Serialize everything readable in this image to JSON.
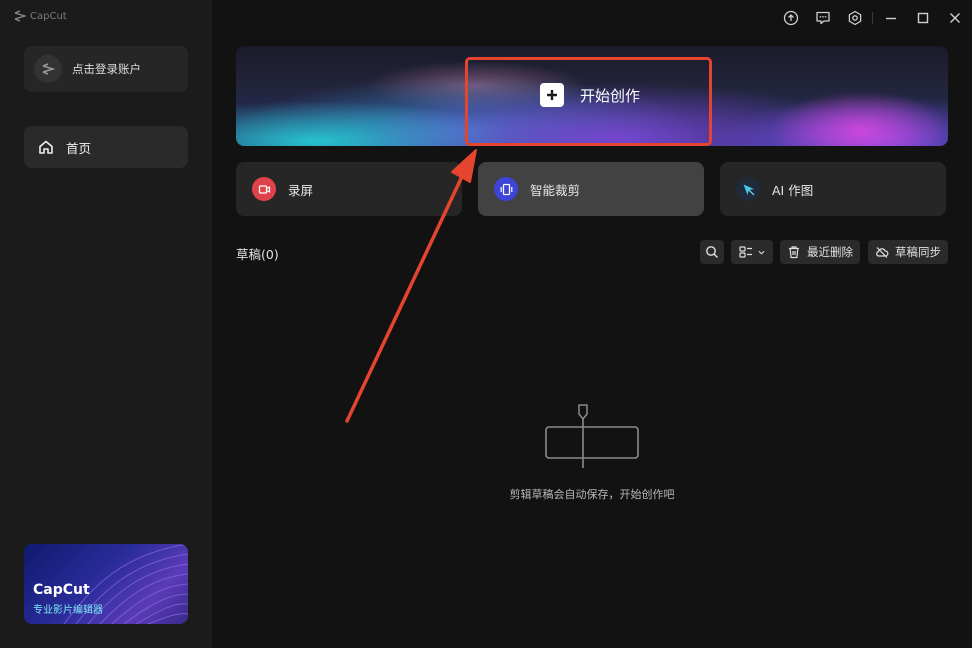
{
  "app": {
    "logo_text": "CapCut"
  },
  "sidebar": {
    "login_label": "点击登录账户",
    "nav": [
      {
        "label": "首页",
        "icon": "home-icon"
      }
    ],
    "promo": {
      "title": "CapCut",
      "subtitle": "专业影片编辑器"
    }
  },
  "titlebar": {
    "icons": [
      "upload-icon",
      "feedback-icon",
      "settings-icon",
      "minimize-icon",
      "maximize-icon",
      "close-icon"
    ]
  },
  "hero": {
    "label": "开始创作",
    "icon": "plus-icon"
  },
  "quick_actions": [
    {
      "label": "录屏",
      "icon": "screen-record-icon",
      "color": "#e0424c"
    },
    {
      "label": "智能裁剪",
      "icon": "smart-crop-icon",
      "color": "#3c45d8"
    },
    {
      "label": "AI 作图",
      "icon": "ai-draw-icon",
      "color": "#1f2a3a"
    }
  ],
  "drafts": {
    "title": "草稿(0)",
    "recently_deleted_label": "最近删除",
    "sync_label": "草稿同步",
    "empty_text": "剪辑草稿会自动保存，开始创作吧"
  },
  "colors": {
    "highlight": "#e5452f",
    "accent_cyan": "#7ee8f2"
  }
}
